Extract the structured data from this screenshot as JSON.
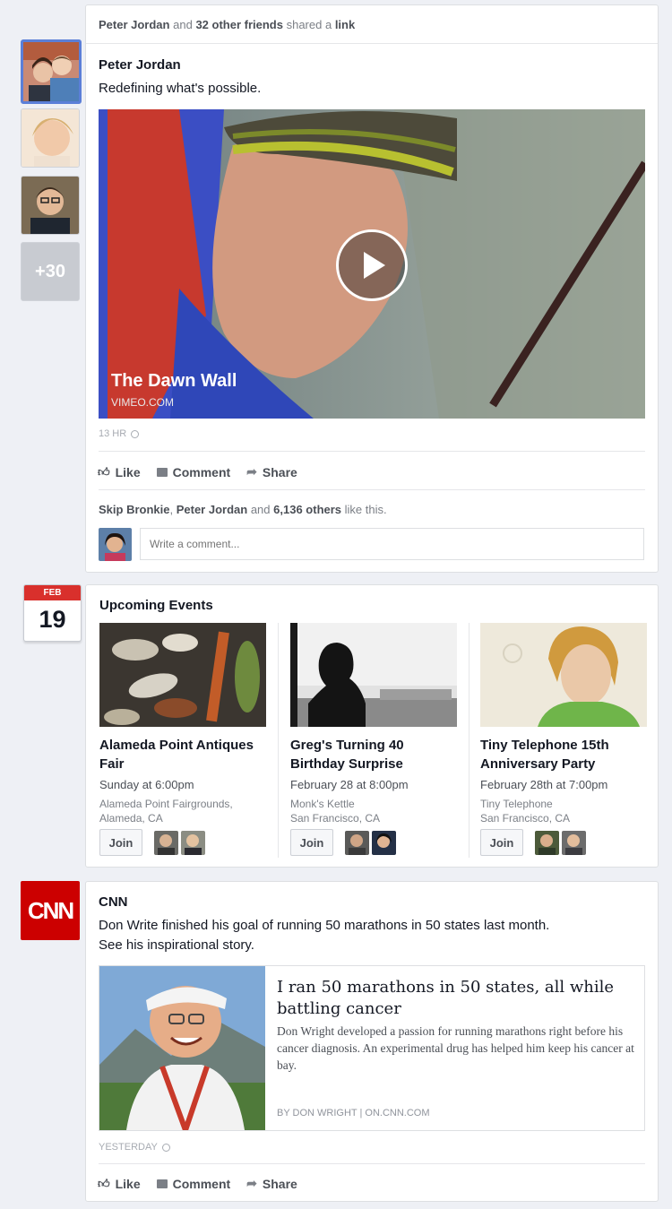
{
  "post1": {
    "story_actor": "Peter Jordan",
    "story_mid": "and",
    "story_count": "32 other friends",
    "story_end": "shared a",
    "story_link": "link",
    "author": "Peter Jordan",
    "message": "Redefining what's possible.",
    "more_friends": "+30",
    "video_title": "The Dawn Wall",
    "video_source": "VIMEO.COM",
    "timestamp": "13 HR",
    "like": "Like",
    "comment": "Comment",
    "share": "Share",
    "likes_name1": "Skip Bronkie",
    "likes_sep": ",",
    "likes_name2": "Peter Jordan",
    "likes_and": "and",
    "likes_count": "6,136 others",
    "likes_end": "like this.",
    "comment_placeholder": "Write a comment..."
  },
  "events": {
    "cal_month": "FEB",
    "cal_day": "19",
    "heading": "Upcoming Events",
    "join": "Join",
    "items": [
      {
        "title": "Alameda Point Antiques Fair",
        "when": "Sunday at 6:00pm",
        "place": "Alameda Point Fairgrounds,",
        "city": "Alameda, CA"
      },
      {
        "title": "Greg's Turning 40 Birthday Surprise",
        "when": "February 28 at 8:00pm",
        "place": "Monk's Kettle",
        "city": "San Francisco, CA"
      },
      {
        "title": "Tiny Telephone 15th Anniversary Party",
        "when": "February 28th at 7:00pm",
        "place": "Tiny Telephone",
        "city": "San Francisco, CA"
      }
    ]
  },
  "post2": {
    "logo": "CNN",
    "author": "CNN",
    "message_line1": "Don Write finished his goal of running 50 marathons in 50 states last month.",
    "message_line2": "See his inspirational story.",
    "article_title": "I ran 50 marathons in 50 states, all while battling cancer",
    "article_desc": "Don Wright developed a passion for running marathons right before his cancer diagnosis. An experimental drug has helped him keep his cancer at bay.",
    "article_byline": "BY DON WRIGHT | ON.CNN.COM",
    "timestamp": "YESTERDAY",
    "like": "Like",
    "comment": "Comment",
    "share": "Share"
  },
  "colors": {
    "accent": "#5b7fd8",
    "cnn_red": "#cc0000",
    "calendar_red": "#d9302c"
  }
}
